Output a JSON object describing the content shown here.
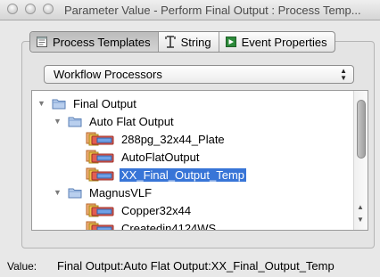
{
  "window": {
    "title": "Parameter Value - Perform Final Output : Process Temp..."
  },
  "tabs": [
    {
      "label": "Process Templates",
      "icon": "notepad-icon",
      "active": true
    },
    {
      "label": "String",
      "icon": "text-cursor-icon",
      "active": false
    },
    {
      "label": "Event Properties",
      "icon": "flag-icon",
      "active": false
    }
  ],
  "dropdown": {
    "selected": "Workflow Processors"
  },
  "tree": {
    "items": [
      {
        "label": "Final Output",
        "kind": "folder"
      },
      {
        "label": "Auto Flat Output",
        "kind": "folder"
      },
      {
        "label": "288pg_32x44_Plate",
        "kind": "processor"
      },
      {
        "label": "AutoFlatOutput",
        "kind": "processor"
      },
      {
        "label": "XX_Final_Output_Temp",
        "kind": "processor",
        "selected": true
      },
      {
        "label": "MagnusVLF",
        "kind": "folder"
      },
      {
        "label": "Copper32x44",
        "kind": "processor"
      },
      {
        "label": "Createdin4124WS",
        "kind": "processor"
      }
    ]
  },
  "footer": {
    "value_label": "Value:",
    "value_text": "Final Output:Auto Flat Output:XX_Final_Output_Temp"
  },
  "colors": {
    "selection": "#3875d7",
    "folder": "#8fb0dc"
  }
}
